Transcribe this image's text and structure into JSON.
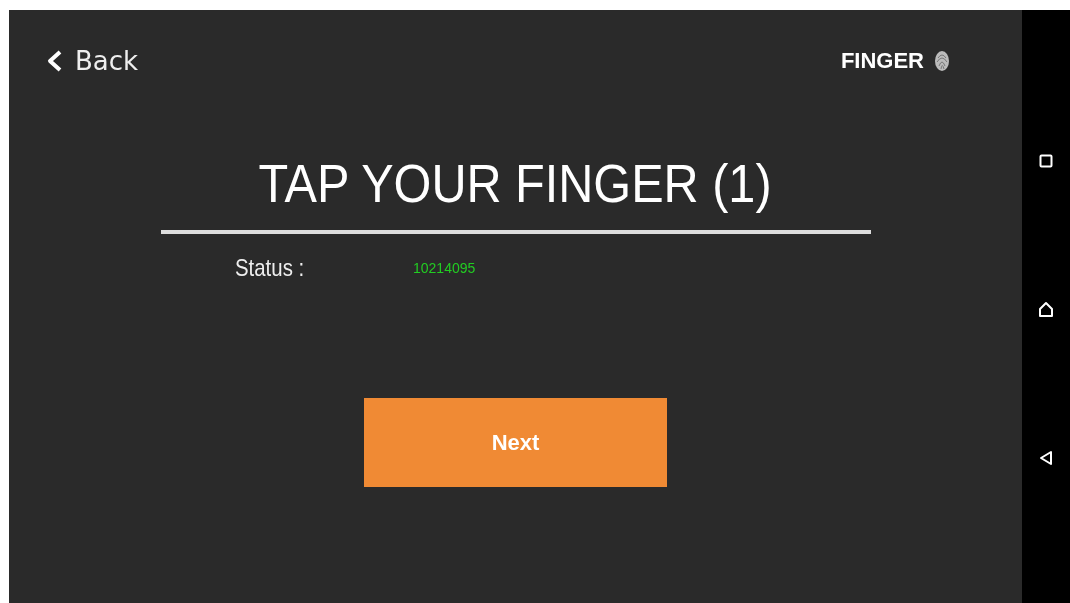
{
  "header": {
    "back_label": "Back",
    "title": "FINGER"
  },
  "heading": "TAP YOUR FINGER (1)",
  "status": {
    "label": "Status :",
    "value": "10214095"
  },
  "buttons": [
    "Next"
  ]
}
